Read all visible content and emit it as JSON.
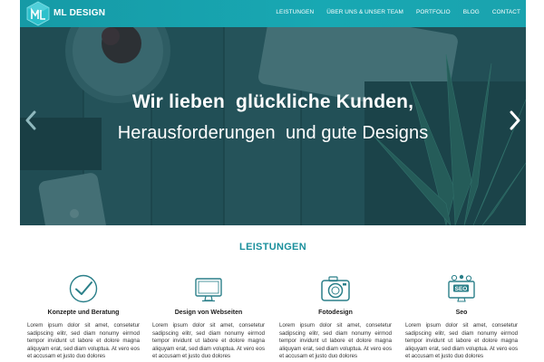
{
  "brand": {
    "name": "ML DESIGN",
    "accent": "#18a8b3"
  },
  "nav": {
    "items": [
      {
        "label": "LEISTUNGEN"
      },
      {
        "label": "ÜBER UNS & UNSER TEAM"
      },
      {
        "label": "PORTFOLIO"
      },
      {
        "label": "BLOG"
      },
      {
        "label": "CONTACT"
      }
    ]
  },
  "hero": {
    "title": "Wir lieben  glückliche Kunden,",
    "subtitle": "Herausforderungen  und gute Designs",
    "prev_icon": "chevron-left-icon",
    "next_icon": "chevron-right-icon"
  },
  "services": {
    "heading": "LEISTUNGEN",
    "items": [
      {
        "icon": "checkmark-circle-icon",
        "title": "Konzepte und Beratung",
        "text": "Lorem ipsum dolor sit amet, consetetur sadipscing elitr, sed diam nonumy eirmod tempor invidunt ut labore et dolore magna aliquyam erat, sed diam voluptua. At vero eos et accusam et justo duo dolores"
      },
      {
        "icon": "monitor-icon",
        "title": "Design von Webseiten",
        "text": "Lorem ipsum dolor sit amet, consetetur sadipscing elitr, sed diam nonumy eirmod tempor invidunt ut labore et dolore magna aliquyam erat, sed diam voluptua. At vero eos et accusam et justo duo dolores"
      },
      {
        "icon": "camera-icon",
        "title": "Fotodesign",
        "text": "Lorem ipsum dolor sit amet, consetetur sadipscing elitr, sed diam nonumy eirmod tempor invidunt ut labore et dolore magna aliquyam erat, sed diam voluptua. At vero eos et accusam et justo duo dolores"
      },
      {
        "icon": "seo-icon",
        "title": "Seo",
        "icon_text": "SEO",
        "text": "Lorem ipsum dolor sit amet, consetetur sadipscing elitr, sed diam nonumy eirmod tempor invidunt ut labore et dolore magna aliquyam erat, sed diam voluptua. At vero eos et accusam et justo duo dolores"
      }
    ]
  }
}
